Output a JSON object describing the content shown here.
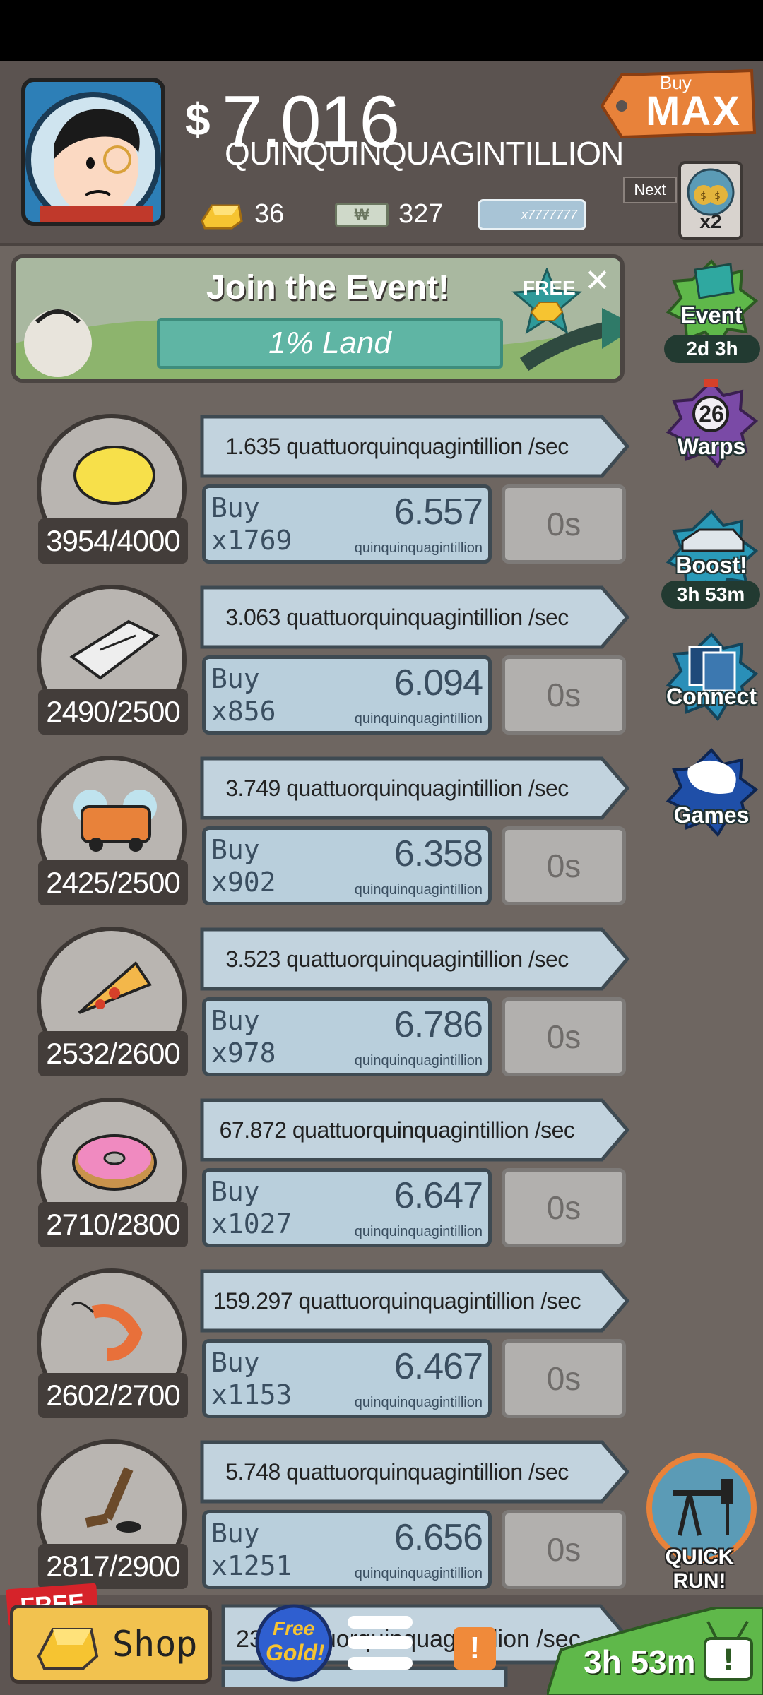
{
  "header": {
    "currency_symbol": "$",
    "money_value": "7.016",
    "money_unit": "QUINQUINQUAGINTILLION",
    "gold": "36",
    "megabucks": "327",
    "mega_ticket": "x7777777",
    "buy_max_small": "Buy",
    "buy_max_big": "MAX",
    "next_label": "Next",
    "next_multiplier": "x2"
  },
  "event": {
    "title": "Join the Event!",
    "bar_text": "1% Land",
    "free_label": "FREE",
    "close": "✕"
  },
  "side_buttons": [
    {
      "label": "Event",
      "timer": "2d 3h"
    },
    {
      "label": "Warps",
      "count": "26"
    },
    {
      "label": "Boost!",
      "timer": "3h 53m"
    },
    {
      "label": "Connect"
    },
    {
      "label": "Games"
    }
  ],
  "businesses": [
    {
      "name": "lemon",
      "count": "3954/4000",
      "rate": "1.635 quattuorquinquagintillion /sec",
      "buy_label": "Buy",
      "qty": "x1769",
      "cost": "6.557",
      "cost_unit": "quinquinquagintillion",
      "timer": "0s",
      "progress": 0.9885
    },
    {
      "name": "newspaper",
      "count": "2490/2500",
      "rate": "3.063 quattuorquinquagintillion /sec",
      "buy_label": "Buy",
      "qty": "x856",
      "cost": "6.094",
      "cost_unit": "quinquinquagintillion",
      "timer": "0s",
      "progress": 0.996
    },
    {
      "name": "car-wash",
      "count": "2425/2500",
      "rate": "3.749 quattuorquinquagintillion /sec",
      "buy_label": "Buy",
      "qty": "x902",
      "cost": "6.358",
      "cost_unit": "quinquinquagintillion",
      "timer": "0s",
      "progress": 0.97
    },
    {
      "name": "pizza",
      "count": "2532/2600",
      "rate": "3.523 quattuorquinquagintillion /sec",
      "buy_label": "Buy",
      "qty": "x978",
      "cost": "6.786",
      "cost_unit": "quinquinquagintillion",
      "timer": "0s",
      "progress": 0.974
    },
    {
      "name": "donut",
      "count": "2710/2800",
      "rate": "67.872 quattuorquinquagintillion /sec",
      "buy_label": "Buy",
      "qty": "x1027",
      "cost": "6.647",
      "cost_unit": "quinquinquagintillion",
      "timer": "0s",
      "progress": 0.968
    },
    {
      "name": "shrimp",
      "count": "2602/2700",
      "rate": "159.297 quattuorquinquagintillion /sec",
      "buy_label": "Buy",
      "qty": "x1153",
      "cost": "6.467",
      "cost_unit": "quinquinquagintillion",
      "timer": "0s",
      "progress": 0.964
    },
    {
      "name": "hockey",
      "count": "2817/2900",
      "rate": "5.748 quattuorquinquagintillion /sec",
      "buy_label": "Buy",
      "qty": "x1251",
      "cost": "6.656",
      "cost_unit": "quinquinquagintillion",
      "timer": "0s",
      "progress": 0.971
    }
  ],
  "bottom": {
    "free_tag": "FREE",
    "shop_label": "Shop",
    "free_gold_1": "Free",
    "free_gold_2": "Gold!",
    "partial_rate": "23 quattuorquinquagintillion /sec",
    "alert": "!",
    "tv_timer": "3h 53m",
    "quick_run": "QUICK RUN!"
  },
  "colors": {
    "background": "#6e6661",
    "event_green": "#5fb84a",
    "warps_purple": "#7a4aa6",
    "boost_teal": "#2a9ab8",
    "games_blue": "#1f4fa8",
    "shop_gold": "#f2c24f"
  }
}
